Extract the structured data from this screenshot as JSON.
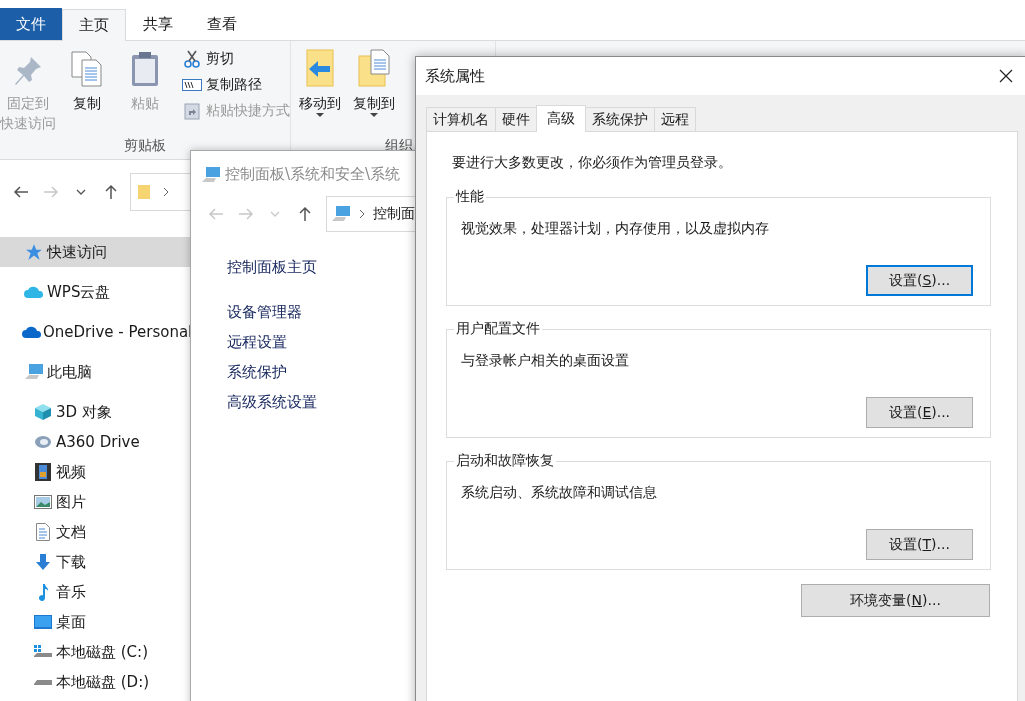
{
  "explorer": {
    "ribbon_tabs": [
      {
        "label": "文件",
        "kind": "file",
        "selected": false
      },
      {
        "label": "主页",
        "kind": "tab",
        "selected": true
      },
      {
        "label": "共享",
        "kind": "tab",
        "selected": false
      },
      {
        "label": "查看",
        "kind": "tab",
        "selected": false
      }
    ],
    "clipboard_group": {
      "label": "剪贴板",
      "large_buttons": [
        {
          "lines": [
            "固定到",
            "快速访问"
          ],
          "disabled": true
        },
        {
          "lines": [
            "复制"
          ],
          "disabled": false
        },
        {
          "lines": [
            "粘贴"
          ],
          "disabled": true
        }
      ],
      "small_buttons": [
        {
          "label": "剪切",
          "disabled": false
        },
        {
          "label": "复制路径",
          "disabled": false
        },
        {
          "label": "粘贴快捷方式",
          "disabled": true
        }
      ]
    },
    "organize_group": {
      "label": "组织",
      "large_buttons": [
        {
          "lines": [
            "移动到"
          ],
          "dropdown": true
        },
        {
          "lines": [
            "复制到"
          ],
          "dropdown": true
        }
      ]
    },
    "nav_buttons": [
      {
        "kind": "back",
        "disabled": false
      },
      {
        "kind": "forward",
        "disabled": true
      },
      {
        "kind": "recent",
        "disabled": false
      },
      {
        "kind": "up",
        "disabled": false
      }
    ],
    "sidebar": [
      {
        "label": "快速访问",
        "selected": true
      },
      {
        "label": "WPS云盘",
        "selected": false
      },
      {
        "label": "OneDrive - Personal",
        "selected": false
      },
      {
        "label": "此电脑",
        "selected": false,
        "children": [
          {
            "label": "3D 对象",
            "selected": false
          },
          {
            "label": "A360 Drive",
            "selected": false
          },
          {
            "label": "视频",
            "selected": false
          },
          {
            "label": "图片",
            "selected": false
          },
          {
            "label": "文档",
            "selected": false
          },
          {
            "label": "下载",
            "selected": false
          },
          {
            "label": "音乐",
            "selected": false
          },
          {
            "label": "桌面",
            "selected": false
          },
          {
            "label": "本地磁盘 (C:)",
            "selected": false
          },
          {
            "label": "本地磁盘 (D:)",
            "selected": false
          }
        ]
      }
    ]
  },
  "control_panel": {
    "title": "控制面板\\系统和安全\\系统",
    "nav_buttons": [
      {
        "kind": "back",
        "disabled": true
      },
      {
        "kind": "forward",
        "disabled": true
      },
      {
        "kind": "recent",
        "disabled": true
      },
      {
        "kind": "up",
        "disabled": false
      }
    ],
    "address": "控制面",
    "links": [
      "控制面板主页",
      "设备管理器",
      "远程设置",
      "系统保护",
      "高级系统设置"
    ]
  },
  "dialog": {
    "title": "系统属性",
    "tabs": [
      {
        "label": "计算机名",
        "selected": false
      },
      {
        "label": "硬件",
        "selected": false
      },
      {
        "label": "高级",
        "selected": true
      },
      {
        "label": "系统保护",
        "selected": false
      },
      {
        "label": "远程",
        "selected": false
      }
    ],
    "notice": "要进行大多数更改，你必须作为管理员登录。",
    "groups": [
      {
        "title": "性能",
        "description": "视觉效果，处理器计划，内存使用，以及虚拟内存",
        "button": {
          "before": "设置(",
          "key": "S",
          "after": ")...",
          "focused": true
        }
      },
      {
        "title": "用户配置文件",
        "description": "与登录帐户相关的桌面设置",
        "button": {
          "before": "设置(",
          "key": "E",
          "after": ")...",
          "focused": false
        }
      },
      {
        "title": "启动和故障恢复",
        "description": "系统启动、系统故障和调试信息",
        "button": {
          "before": "设置(",
          "key": "T",
          "after": ")...",
          "focused": false
        }
      }
    ],
    "env_button": {
      "before": "环境变量(",
      "key": "N",
      "after": ")...",
      "focused": false
    }
  }
}
